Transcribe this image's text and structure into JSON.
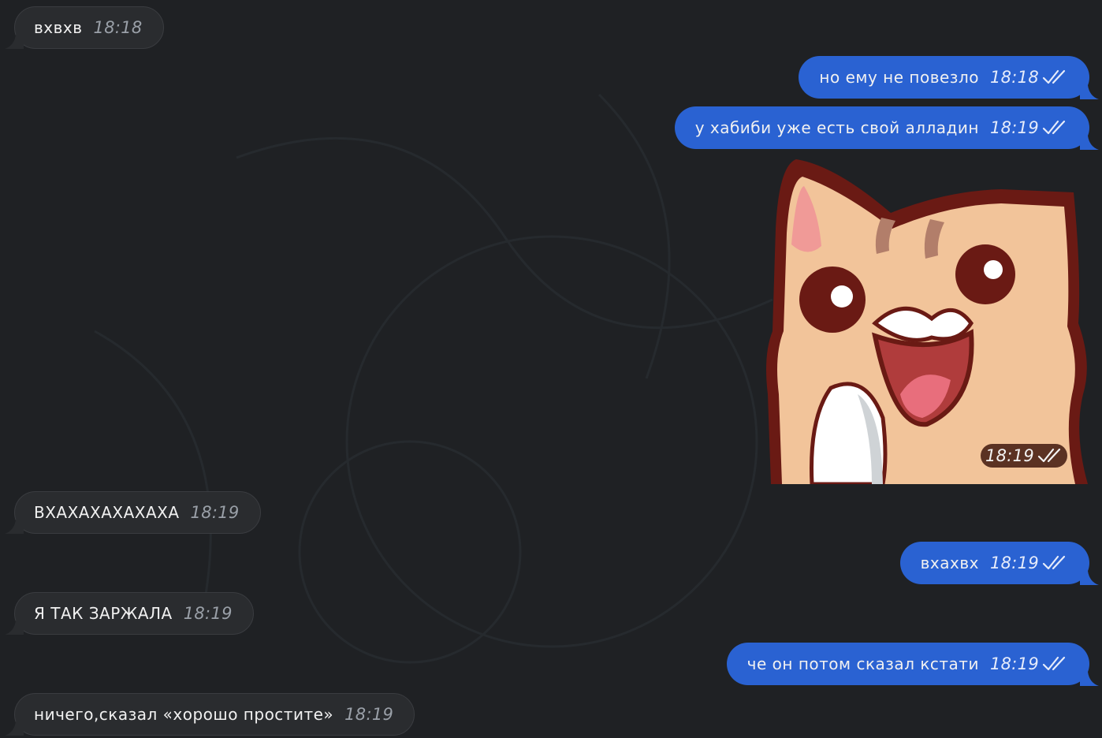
{
  "messages": [
    {
      "text": "вхвхв",
      "time": "18:18",
      "direction": "incoming"
    },
    {
      "text": "но ему не повезло",
      "time": "18:18",
      "direction": "outgoing",
      "status": "double-check-icon"
    },
    {
      "text": "у хабиби уже есть свой алладин",
      "time": "18:19",
      "direction": "outgoing",
      "status": "double-check-icon"
    },
    {
      "sticker": "laughing-cat-sticker",
      "time": "18:19",
      "direction": "outgoing",
      "status": "double-check-icon"
    },
    {
      "text": "ВХАХАХАХАХАХА",
      "time": "18:19",
      "direction": "incoming"
    },
    {
      "text": "вхахвх",
      "time": "18:19",
      "direction": "outgoing",
      "status": "double-check-icon"
    },
    {
      "text": "Я ТАК ЗАРЖАЛА",
      "time": "18:19",
      "direction": "incoming"
    },
    {
      "text": "че он потом сказал кстати",
      "time": "18:19",
      "direction": "outgoing",
      "status": "double-check-icon"
    },
    {
      "text": "ничего,сказал «хорошо простите»",
      "time": "18:19",
      "direction": "incoming"
    }
  ],
  "colors": {
    "background": "#1f2124",
    "incoming_bubble": "#2a2c2f",
    "outgoing_bubble": "#2a62d2"
  }
}
